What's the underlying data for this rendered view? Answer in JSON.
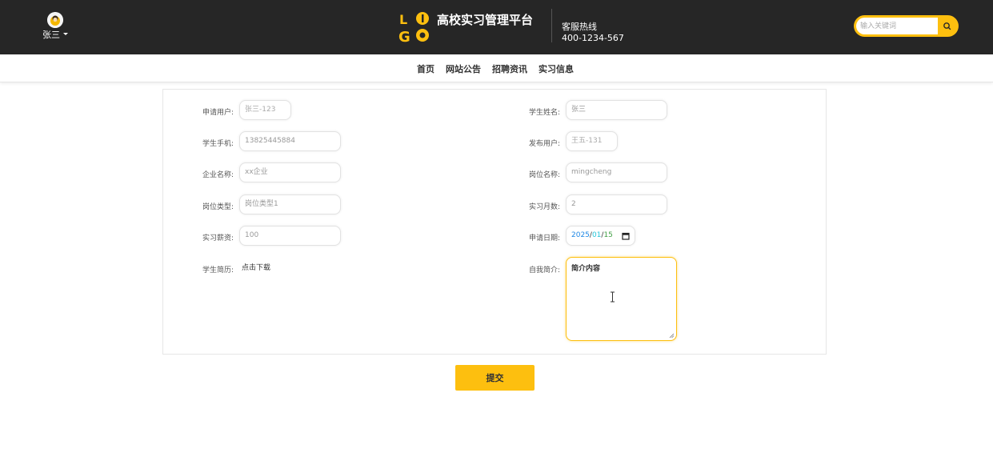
{
  "header": {
    "user_name": "张三",
    "site_title": "高校实习管理平台",
    "hotline_label": "客服热线",
    "hotline_number": "400-1234-567",
    "search_placeholder": "输入关键词",
    "brand_color": "#fdbf0f",
    "bar_color": "#262626"
  },
  "nav": {
    "items": [
      {
        "label": "首页"
      },
      {
        "label": "网站公告"
      },
      {
        "label": "招聘资讯"
      },
      {
        "label": "实习信息"
      }
    ]
  },
  "form": {
    "apply_user": {
      "label": "申请用户:",
      "value": "张三-123"
    },
    "student_name": {
      "label": "学生姓名:",
      "value": "张三"
    },
    "student_phone": {
      "label": "学生手机:",
      "value": "13825445884"
    },
    "publish_user": {
      "label": "发布用户:",
      "value": "王五-131"
    },
    "company_name": {
      "label": "企业名称:",
      "value": "xx企业"
    },
    "position_name": {
      "label": "岗位名称:",
      "value": "mingcheng"
    },
    "position_type": {
      "label": "岗位类型:",
      "value": "岗位类型1"
    },
    "internship_months": {
      "label": "实习月数:",
      "value": "2"
    },
    "salary": {
      "label": "实习薪资:",
      "value": "100"
    },
    "apply_date": {
      "label": "申请日期:",
      "year": "2025",
      "month": "01",
      "day": "15",
      "sep": "/"
    },
    "resume": {
      "label": "学生简历:",
      "link": "点击下载"
    },
    "intro": {
      "label": "自我简介:",
      "value": "简介内容"
    }
  },
  "actions": {
    "submit_label": "提交"
  }
}
